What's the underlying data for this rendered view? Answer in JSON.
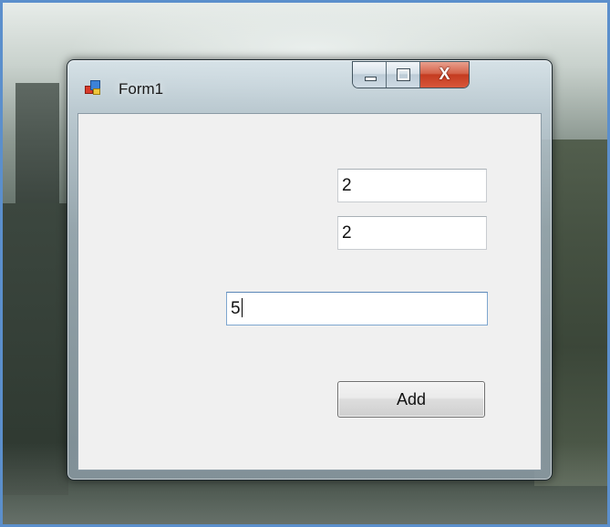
{
  "window": {
    "title": "Form1",
    "controls": {
      "minimize_icon": "minimize-icon",
      "maximize_icon": "maximize-icon",
      "close_label": "X"
    }
  },
  "form": {
    "input_a": "2",
    "input_b": "2",
    "result": "5",
    "add_button_label": "Add"
  }
}
